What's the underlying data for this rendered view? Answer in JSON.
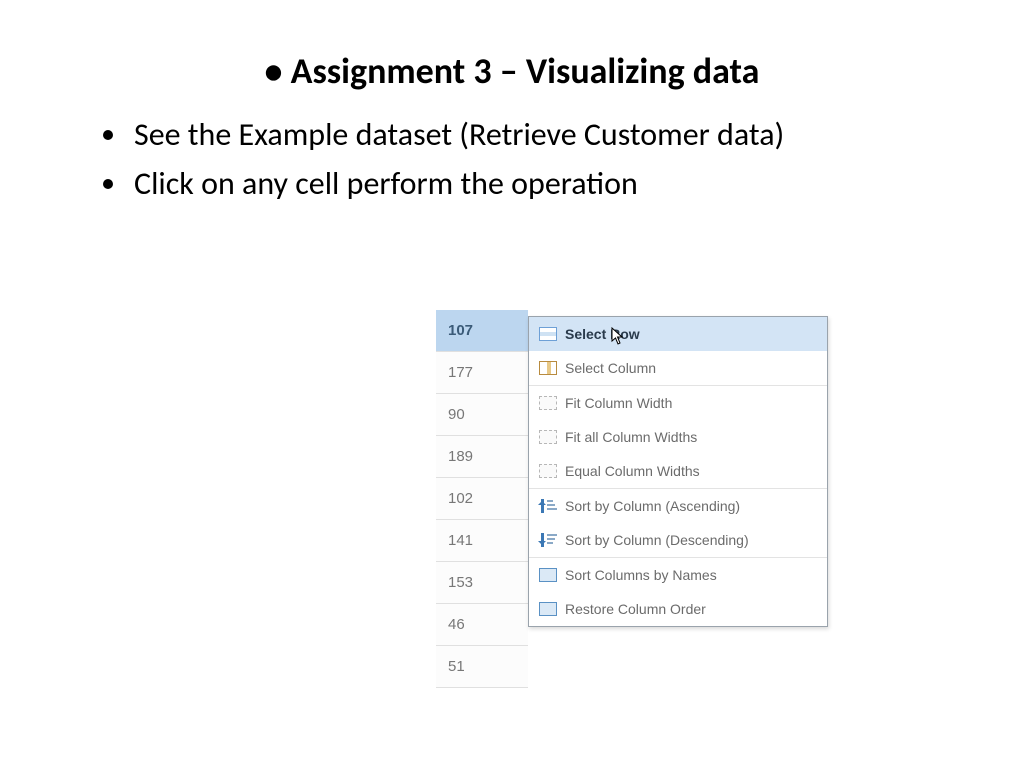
{
  "title": "Assignment 3 – Visualizing data",
  "bullets": [
    "See the Example dataset (Retrieve Customer data)",
    "Click on any cell perform the operation"
  ],
  "column_values": [
    "107",
    "177",
    "90",
    "189",
    "102",
    "141",
    "153",
    "46",
    "51"
  ],
  "menu": {
    "items": [
      {
        "label": "Select Row",
        "icon": "row",
        "hl": true
      },
      {
        "label": "Select Column",
        "icon": "col",
        "hl": false
      },
      {
        "label": "Fit Column Width",
        "icon": "fit",
        "hl": false,
        "sep_before": true
      },
      {
        "label": "Fit all Column Widths",
        "icon": "fit",
        "hl": false
      },
      {
        "label": "Equal Column Widths",
        "icon": "fit",
        "hl": false
      },
      {
        "label": "Sort by Column (Ascending)",
        "icon": "asc",
        "hl": false,
        "sep_before": true
      },
      {
        "label": "Sort by Column (Descending)",
        "icon": "desc",
        "hl": false
      },
      {
        "label": "Sort Columns by Names",
        "icon": "sortnames",
        "hl": false,
        "sep_before": true
      },
      {
        "label": "Restore Column Order",
        "icon": "restore",
        "hl": false
      }
    ]
  }
}
